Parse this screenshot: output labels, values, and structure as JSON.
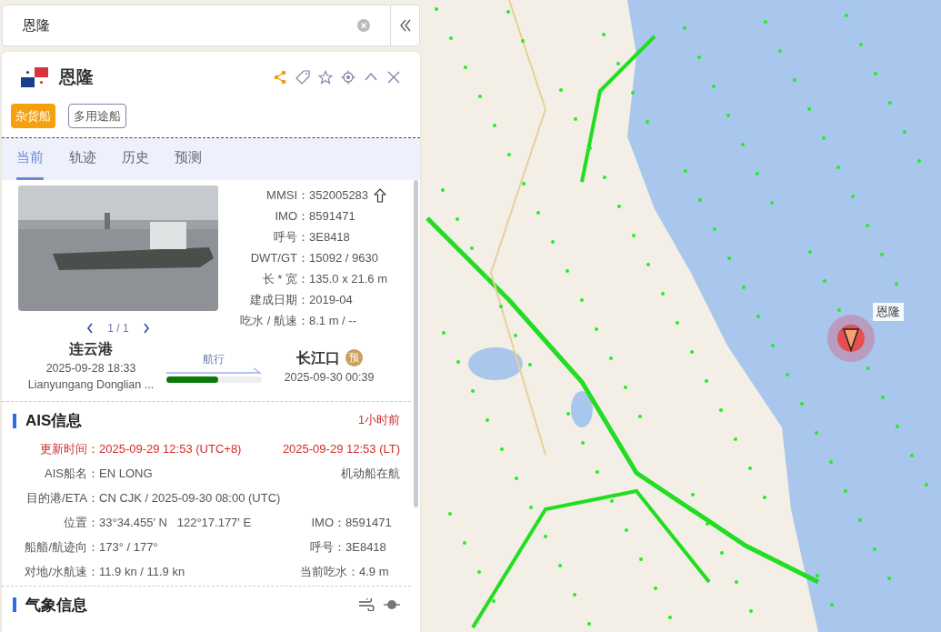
{
  "search": {
    "value": "恩隆"
  },
  "ship": {
    "name": "恩隆",
    "tags": [
      {
        "label": "杂货船",
        "selected": true
      },
      {
        "label": "多用途船",
        "selected": false
      }
    ]
  },
  "tabs": [
    {
      "label": "当前",
      "selected": true
    },
    {
      "label": "轨迹",
      "selected": false
    },
    {
      "label": "历史",
      "selected": false
    },
    {
      "label": "预测",
      "selected": false
    }
  ],
  "details": [
    {
      "label": "MMSI：",
      "value": "352005283"
    },
    {
      "label": "IMO：",
      "value": "8591471"
    },
    {
      "label": "呼号：",
      "value": "3E8418"
    },
    {
      "label": "DWT/GT：",
      "value": "15092 / 9630"
    },
    {
      "label": "长 * 宽：",
      "value": "135.0 x 21.6 m"
    },
    {
      "label": "建成日期：",
      "value": "2019-04"
    },
    {
      "label": "吃水 / 航速：",
      "value": "8.1 m / --"
    }
  ],
  "photo_pager": "1 / 1",
  "voyage": {
    "from": {
      "port": "连云港",
      "time": "2025-09-28 18:33",
      "berth": "Lianyungang Donglian ..."
    },
    "status": "航行",
    "level": 0.55,
    "to": {
      "port": "长江口",
      "badge": "预",
      "time": "2025-09-30 00:39"
    }
  },
  "ais": {
    "title": "AIS信息",
    "age": "1小时前",
    "update_label": "更新时间：",
    "update_utc": "2025-09-29 12:53 (UTC+8)",
    "update_lt": "2025-09-29 12:53 (LT)",
    "rows": [
      {
        "label": "AIS船名：",
        "value": "EN LONG",
        "right_value": "机动船在航"
      },
      {
        "label": "目的港/ETA：",
        "value": "CN CJK / 2025-09-30 08:00 (UTC)"
      },
      {
        "label": "位置：",
        "value": "33°34.455′ N   122°17.177′ E",
        "right_label": "IMO：",
        "right_value": "8591471"
      },
      {
        "label": "船艏/航迹向：",
        "value": "173° / 177°",
        "right_label": "呼号：",
        "right_value": "3E8418"
      },
      {
        "label": "对地/水航速：",
        "value": "11.9 kn / 11.9 kn",
        "right_label": "当前吃水：",
        "right_value": "4.9 m"
      }
    ]
  },
  "weather": {
    "title": "气象信息"
  },
  "map": {
    "ship_label": "恩隆"
  }
}
